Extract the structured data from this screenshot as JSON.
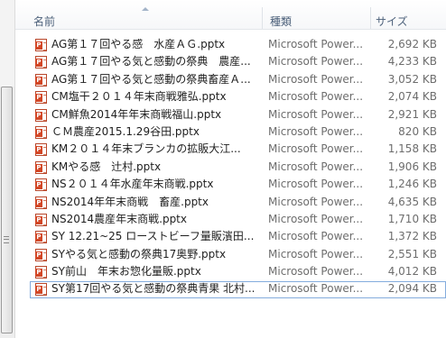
{
  "columns": {
    "name": "名前",
    "type": "種類",
    "size": "サイズ"
  },
  "files": [
    {
      "name": "AG第１７回やる感　水産ＡＧ.pptx",
      "type": "Microsoft Power...",
      "size": "2,692 KB"
    },
    {
      "name": "AG第１７回やる気と感動の祭典　農産...",
      "type": "Microsoft Power...",
      "size": "4,233 KB"
    },
    {
      "name": "AG第１７回やる気と感動の祭典畜産Ａ...",
      "type": "Microsoft Power...",
      "size": "3,052 KB"
    },
    {
      "name": "CM塩干２０１４年末商戦雅弘.pptx",
      "type": "Microsoft Power...",
      "size": "2,074 KB"
    },
    {
      "name": "CM鮮魚2014年年末商戦福山.pptx",
      "type": "Microsoft Power...",
      "size": "2,921 KB"
    },
    {
      "name": "ＣＭ農産2015.1.29谷田.pptx",
      "type": "Microsoft Power...",
      "size": "820 KB"
    },
    {
      "name": "KM２０１４年末ブランカの拡販大江...",
      "type": "Microsoft Power...",
      "size": "1,158 KB"
    },
    {
      "name": "KMやる感　辻村.pptx",
      "type": "Microsoft Power...",
      "size": "1,906 KB"
    },
    {
      "name": "NS２０１４年水産年末商戦.pptx",
      "type": "Microsoft Power...",
      "size": "1,246 KB"
    },
    {
      "name": "NS2014年年末商戦　畜産.pptx",
      "type": "Microsoft Power...",
      "size": "4,635 KB"
    },
    {
      "name": "NS2014農産年末商戦.pptx",
      "type": "Microsoft Power...",
      "size": "1,710 KB"
    },
    {
      "name": "SY 12.21~25 ローストビーフ量販濱田...",
      "type": "Microsoft Power...",
      "size": "1,372 KB"
    },
    {
      "name": "SYやる気と感動の祭典17奥野.pptx",
      "type": "Microsoft Power...",
      "size": "2,551 KB"
    },
    {
      "name": "SY前山　年末お惣化量販.pptx",
      "type": "Microsoft Power...",
      "size": "4,012 KB"
    },
    {
      "name": "SY第17回やる気と感動の祭典青果 北村...",
      "type": "Microsoft Power...",
      "size": "2,094 KB"
    }
  ],
  "icons": {
    "file": "powerpoint-file-icon",
    "badge_letter": "P",
    "accent": "#d24726"
  }
}
